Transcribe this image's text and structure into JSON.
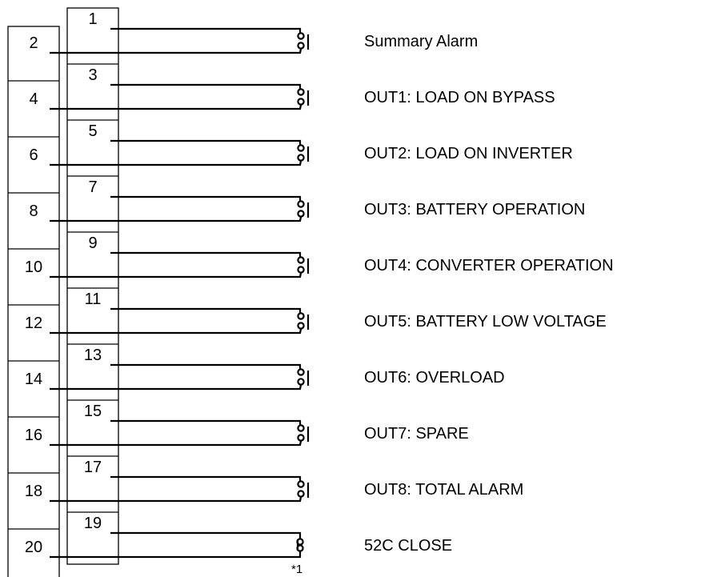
{
  "diagram": {
    "rows": [
      {
        "top": "1",
        "bottom": "2",
        "label": "Summary Alarm",
        "contact": "nc"
      },
      {
        "top": "3",
        "bottom": "4",
        "label": "OUT1: LOAD ON BYPASS",
        "contact": "nc"
      },
      {
        "top": "5",
        "bottom": "6",
        "label": "OUT2: LOAD ON INVERTER",
        "contact": "nc"
      },
      {
        "top": "7",
        "bottom": "8",
        "label": "OUT3: BATTERY OPERATION",
        "contact": "nc"
      },
      {
        "top": "9",
        "bottom": "10",
        "label": "OUT4: CONVERTER OPERATION",
        "contact": "nc"
      },
      {
        "top": "11",
        "bottom": "12",
        "label": "OUT5: BATTERY LOW VOLTAGE",
        "contact": "nc"
      },
      {
        "top": "13",
        "bottom": "14",
        "label": "OUT6: OVERLOAD",
        "contact": "nc"
      },
      {
        "top": "15",
        "bottom": "16",
        "label": "OUT7: SPARE",
        "contact": "nc"
      },
      {
        "top": "17",
        "bottom": "18",
        "label": "OUT8: TOTAL ALARM",
        "contact": "nc"
      },
      {
        "top": "19",
        "bottom": "20",
        "label": "52C CLOSE",
        "contact": "no"
      }
    ],
    "footnote_mark": "*1"
  }
}
